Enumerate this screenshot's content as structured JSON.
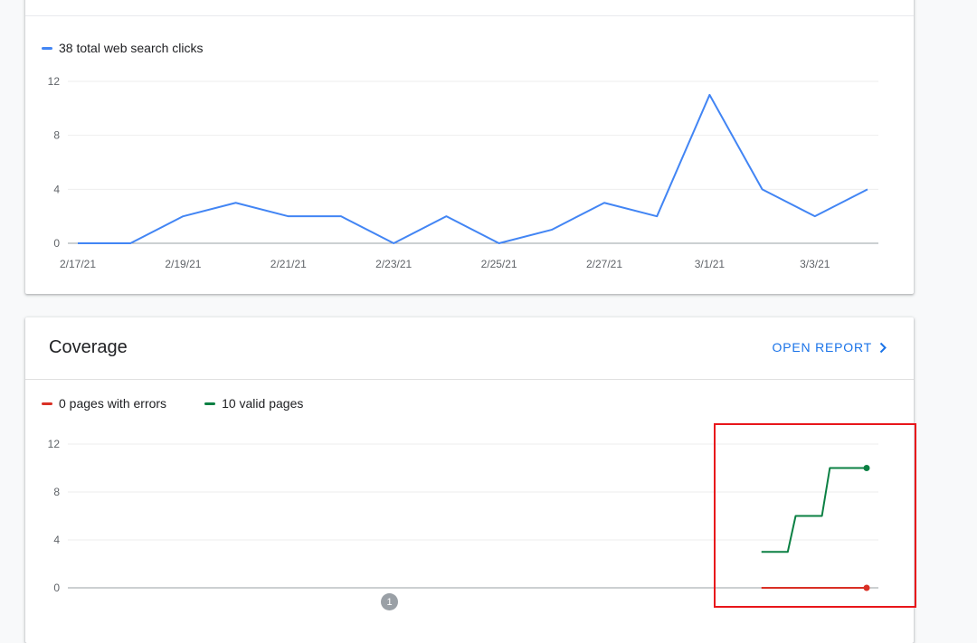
{
  "performance": {
    "legend": [
      {
        "label": "38 total web search clicks",
        "color": "#4285f4"
      }
    ]
  },
  "coverage": {
    "title": "Coverage",
    "open_report_label": "OPEN REPORT",
    "open_report_icon": "chevron-right-icon",
    "legend": [
      {
        "label": "0 pages with errors",
        "color": "#d93025"
      },
      {
        "label": "10 valid pages",
        "color": "#0b8043"
      }
    ],
    "annotation_badge": "1"
  },
  "chart_data": [
    {
      "type": "line",
      "x": [
        "2/17/21",
        "2/18/21",
        "2/19/21",
        "2/20/21",
        "2/21/21",
        "2/22/21",
        "2/23/21",
        "2/24/21",
        "2/25/21",
        "2/26/21",
        "2/27/21",
        "2/28/21",
        "3/1/21",
        "3/2/21",
        "3/3/21",
        "3/4/21"
      ],
      "x_tick_labels": [
        "2/17/21",
        "2/19/21",
        "2/21/21",
        "2/23/21",
        "2/25/21",
        "2/27/21",
        "3/1/21",
        "3/3/21"
      ],
      "series": [
        {
          "name": "38 total web search clicks",
          "color": "#4285f4",
          "values": [
            0,
            0,
            2,
            3,
            2,
            2,
            0,
            2,
            0,
            1,
            3,
            2,
            11,
            4,
            2,
            4
          ]
        }
      ],
      "y_ticks": [
        0,
        4,
        8,
        12
      ],
      "ylim": [
        0,
        12
      ],
      "grid": true
    },
    {
      "type": "line",
      "x_count": 31,
      "series": [
        {
          "name": "0 pages with errors",
          "color": "#d93025",
          "points": [
            [
              26,
              0
            ],
            [
              30,
              0
            ]
          ]
        },
        {
          "name": "10 valid pages",
          "color": "#0b8043",
          "step": true,
          "points": [
            [
              26,
              3
            ],
            [
              27,
              3
            ],
            [
              27.3,
              6
            ],
            [
              28.3,
              6
            ],
            [
              28.6,
              10
            ],
            [
              29.3,
              10
            ],
            [
              30,
              10
            ]
          ]
        }
      ],
      "y_ticks": [
        0,
        4,
        8,
        12
      ],
      "ylim": [
        0,
        12
      ],
      "grid": true
    }
  ]
}
